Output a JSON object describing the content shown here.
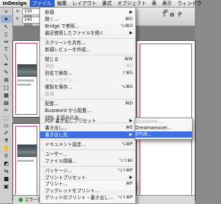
{
  "menubar": {
    "apple": "",
    "items": [
      "InDesign",
      "ファイル",
      "編集",
      "レイアウト",
      "書式",
      "オブジェクト",
      "表",
      "表示",
      "ウィンドウ"
    ],
    "active_index": 1
  },
  "control": {
    "x_value": "330 mm",
    "y_value": "240 mm",
    "w_label": "W:",
    "h_label": "H:",
    "right_icons": "T  ⊕  P"
  },
  "status": {
    "text": "エラーなし"
  },
  "menu": {
    "items": [
      {
        "label": "新規",
        "shortcut": "▶"
      },
      {
        "label": "開く...",
        "shortcut": "⌘O"
      },
      {
        "label": "Bridge で参照...",
        "shortcut": "⌥⌘O"
      },
      {
        "label": "最近使用したファイルを開く",
        "shortcut": "▶"
      },
      {
        "label": "スクリーンを共有...",
        "shortcut": ""
      },
      {
        "label": "新規レビューを作成...",
        "shortcut": ""
      },
      {
        "label": "閉じる",
        "shortcut": "⌘W"
      },
      {
        "label": "保存",
        "shortcut": "⌘S"
      },
      {
        "label": "別名で保存...",
        "shortcut": "⇧⌘S"
      },
      {
        "label": "チェックイン...",
        "shortcut": ""
      },
      {
        "label": "複製を保存...",
        "shortcut": "⌥⌘S"
      },
      {
        "label": "復帰",
        "shortcut": ""
      },
      {
        "label": "配置...",
        "shortcut": "⌘D"
      },
      {
        "label": "Buzzword から配置...",
        "shortcut": ""
      },
      {
        "label": "XML を読み込み...",
        "shortcut": ""
      },
      {
        "label": "PDF 書き出しプリセット",
        "shortcut": "▶"
      },
      {
        "label": "書き出し...",
        "shortcut": "⌘E"
      },
      {
        "label": "書き出し先",
        "shortcut": "▶"
      },
      {
        "label": "ドキュメント設定...",
        "shortcut": "⌥⌘P"
      },
      {
        "label": "ユーザー...",
        "shortcut": ""
      },
      {
        "label": "ファイル情報...",
        "shortcut": "⌥⇧⌘I"
      },
      {
        "label": "パッケージ...",
        "shortcut": "⌥⇧⌘P"
      },
      {
        "label": "プリントプリセット",
        "shortcut": "▶"
      },
      {
        "label": "プリント...",
        "shortcut": "⌘P"
      },
      {
        "label": "ブックレットをプリント...",
        "shortcut": ""
      },
      {
        "label": "グリッドのプリント・書き出し...",
        "shortcut": "⌥⇧⌘P"
      }
    ]
  },
  "submenu": {
    "items": [
      {
        "label": "Buzzword..."
      },
      {
        "label": "Dreamweaver..."
      },
      {
        "label": "EPUB..."
      }
    ]
  }
}
